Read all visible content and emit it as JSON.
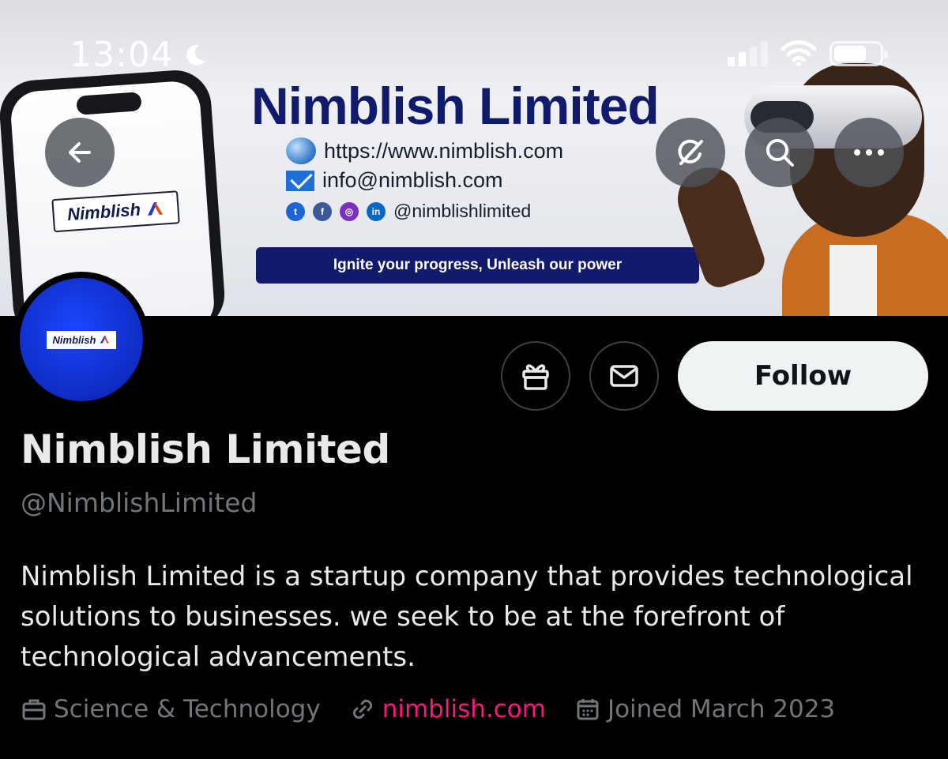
{
  "status_bar": {
    "time": "13:04",
    "moon_icon": "moon-icon",
    "signal_icon": "cellular-signal-icon",
    "wifi_icon": "wifi-icon",
    "battery_icon": "battery-icon"
  },
  "banner": {
    "title": "Nimblish Limited",
    "website": "https://www.nimblish.com",
    "email": "info@nimblish.com",
    "social_handle": "@nimblishlimited",
    "slogan": "Ignite your progress, Unleash our power",
    "phone_logo_text": "Nimblish"
  },
  "nav": {
    "back_icon": "arrow-left-icon",
    "grok_icon": "grok-icon",
    "search_icon": "search-icon",
    "more_icon": "more-horizontal-icon"
  },
  "profile": {
    "avatar_logo_text": "Nimblish",
    "display_name": "Nimblish Limited",
    "handle": "@NimblishLimited",
    "bio": "Nimblish Limited is a startup company that provides technological solutions to businesses. we seek to be at the forefront of technological advancements.",
    "follow_label": "Follow",
    "gift_icon": "gift-icon",
    "message_icon": "envelope-icon",
    "meta": {
      "category": "Science & Technology",
      "website": "nimblish.com",
      "joined": "Joined March 2023"
    }
  },
  "colors": {
    "background": "#000000",
    "link": "#f91880",
    "secondary_text": "#71767b",
    "follow_button": "#eff3f4",
    "brand_navy": "#121a6b"
  }
}
